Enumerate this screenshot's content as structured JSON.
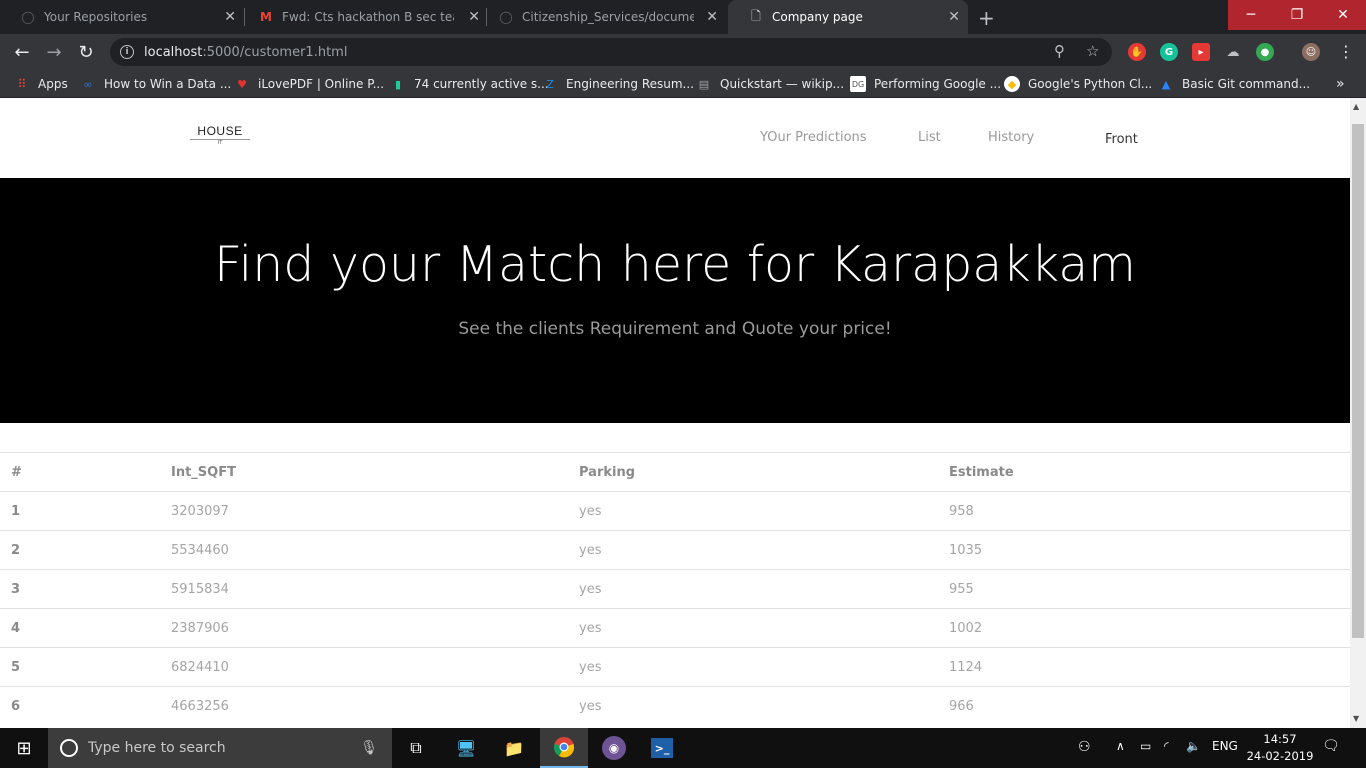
{
  "browser": {
    "tabs": [
      {
        "title": "Your Repositories",
        "icon": "github-icon",
        "active": false
      },
      {
        "title": "Fwd: Cts hackathon B sec team#",
        "icon": "gmail-icon",
        "active": false
      },
      {
        "title": "Citizenship_Services/documentat",
        "icon": "github-icon",
        "active": false
      },
      {
        "title": "Company page",
        "icon": "page-icon",
        "active": true
      }
    ],
    "new_tab": "+",
    "url_host": "localhost",
    "url_rest": ":5000/customer1.html",
    "bookmarks": [
      {
        "label": "Apps",
        "icon": "apps-grid-icon",
        "color": "#ea4335"
      },
      {
        "label": "How to Win a Data ...",
        "icon": "coursera-icon",
        "color": "#2a73cc"
      },
      {
        "label": "iLovePDF | Online P...",
        "icon": "heart-icon",
        "color": "#e5322d"
      },
      {
        "label": "74 currently active s...",
        "icon": "bottle-icon",
        "color": "#20c997"
      },
      {
        "label": "Engineering Resum...",
        "icon": "z-icon",
        "color": "#1e88e5"
      },
      {
        "label": "Quickstart — wikip...",
        "icon": "doc-icon",
        "color": "#9aa0a6"
      },
      {
        "label": "Performing Google ...",
        "icon": "dg-icon",
        "color": "#ffffff"
      },
      {
        "label": "Google's Python Cl...",
        "icon": "google-dev-icon",
        "color": "#fbbc04"
      },
      {
        "label": "Basic Git command...",
        "icon": "atlassian-icon",
        "color": "#2684ff"
      }
    ]
  },
  "site": {
    "logo_main": "HOUSE",
    "logo_sub": "IT",
    "nav": [
      "YOur Predictions",
      "List",
      "History",
      "Front"
    ],
    "hero_title": "Find your Match here for Karapakkam",
    "hero_subtitle": "See the clients Requirement and Quote your price!",
    "table": {
      "headers": [
        "#",
        "Int_SQFT",
        "Parking",
        "Estimate"
      ],
      "rows": [
        [
          "1",
          "3203097",
          "yes",
          "958"
        ],
        [
          "2",
          "5534460",
          "yes",
          "1035"
        ],
        [
          "3",
          "5915834",
          "yes",
          "955"
        ],
        [
          "4",
          "2387906",
          "yes",
          "1002"
        ],
        [
          "5",
          "6824410",
          "yes",
          "1124"
        ],
        [
          "6",
          "4663256",
          "yes",
          "966"
        ]
      ]
    }
  },
  "taskbar": {
    "search_placeholder": "Type here to search",
    "language": "ENG",
    "time": "14:57",
    "date": "24-02-2019"
  }
}
